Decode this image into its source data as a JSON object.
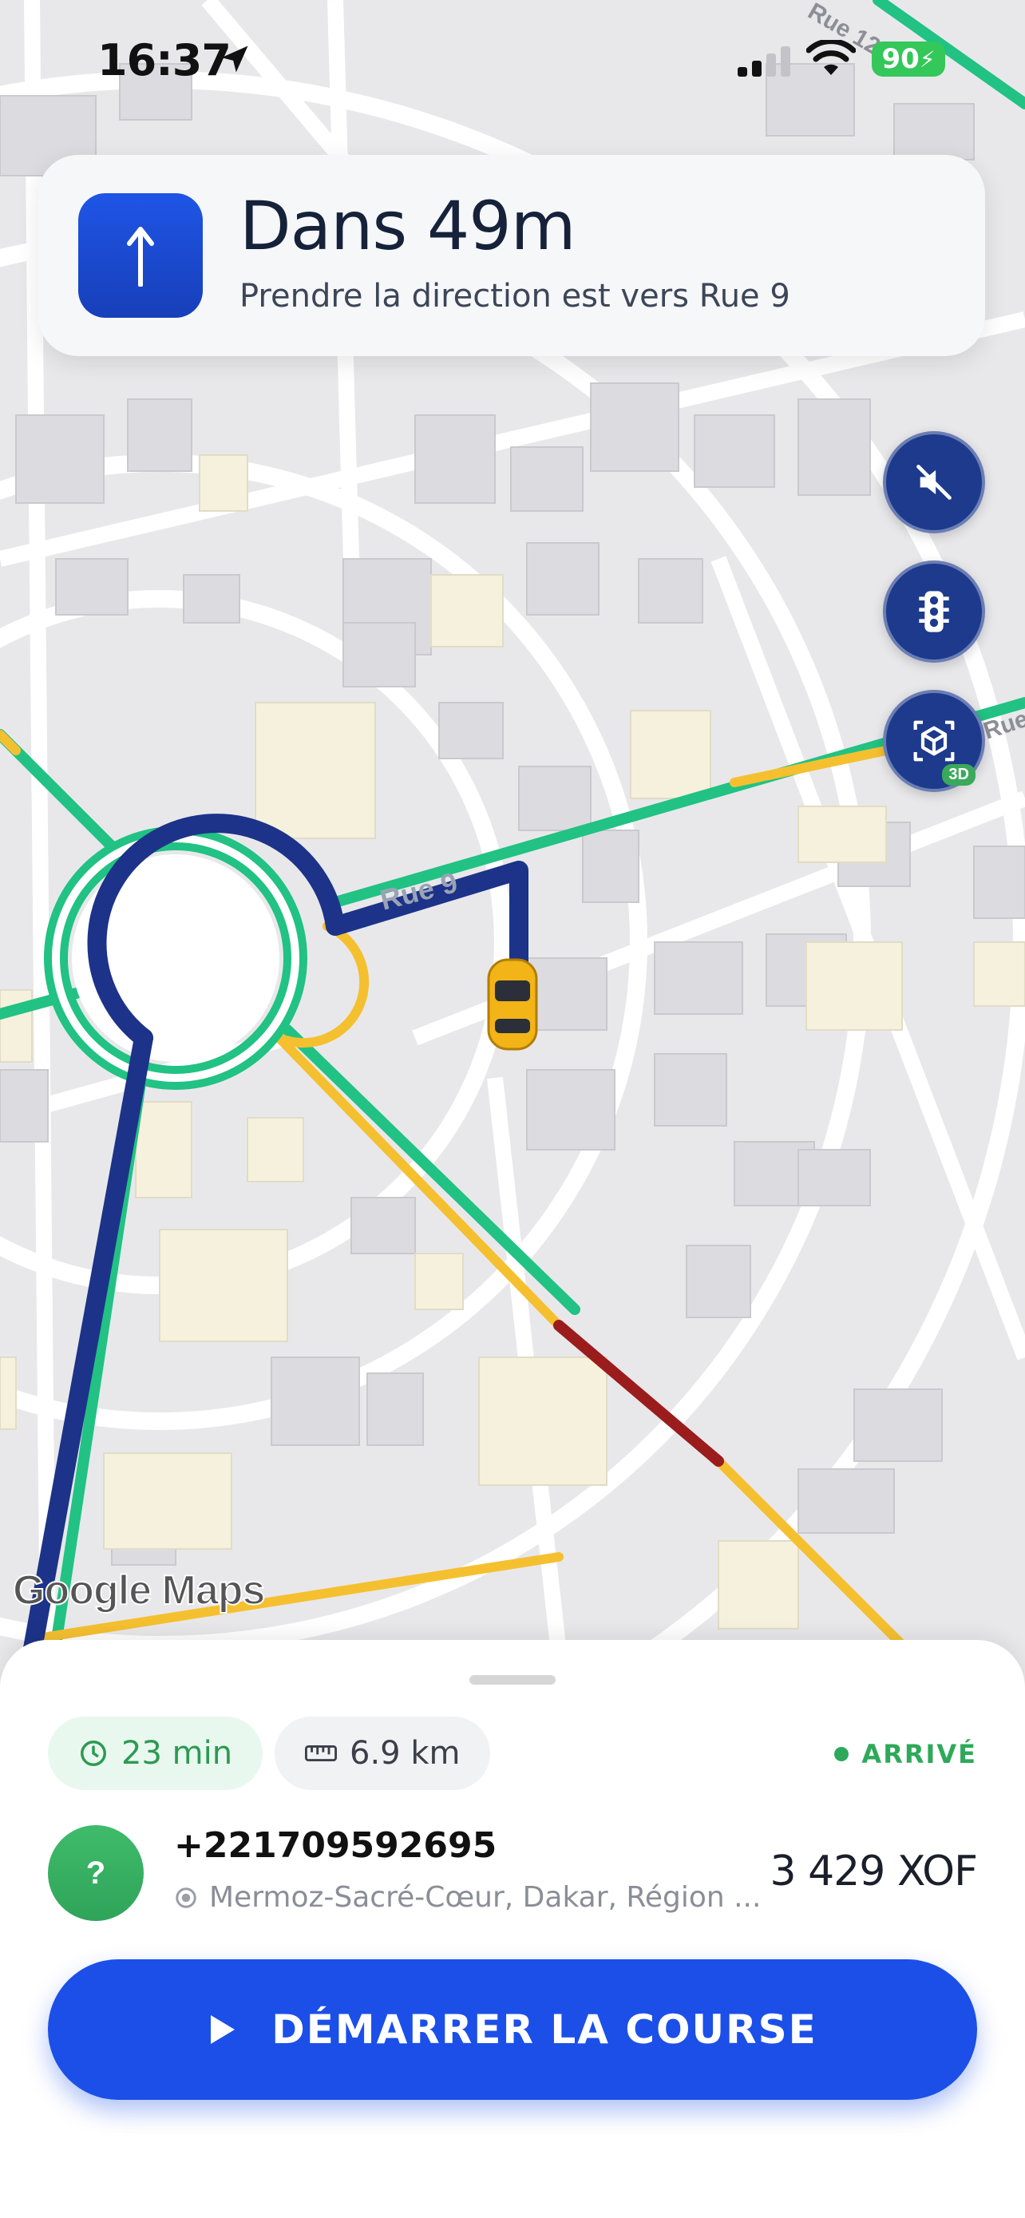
{
  "status_bar": {
    "time": "16:37",
    "battery": "90"
  },
  "navigation": {
    "title": "Dans 49m",
    "instruction": "Prendre la direction est vers Rue 9",
    "street_label": "Rue 9",
    "street_label_top": "Rue 12",
    "street_label_right": "Rue",
    "maneuver_icon": "arrow-up-icon"
  },
  "map_controls": {
    "mute_icon": "volume-mute-icon",
    "traffic_icon": "traffic-light-icon",
    "view_icon": "3d-cube-icon",
    "view_badge": "3D",
    "attribution": "Google Maps"
  },
  "trip": {
    "duration": "23 min",
    "distance": "6.9 km",
    "status": "ARRIVÉ"
  },
  "customer": {
    "avatar": "?",
    "phone": "+221709592695",
    "address": "Mermoz-Sacré-Cœur, Dakar, Région ...",
    "price": "3 429 XOF"
  },
  "action": {
    "label": "DÉMARRER LA COURSE"
  },
  "colors": {
    "primary": "#1b4fe8",
    "route": "#1d3389",
    "traffic_free": "#21c283",
    "traffic_moderate": "#f5c030",
    "traffic_heavy": "#9b1c1c",
    "success": "#2ea95b"
  }
}
